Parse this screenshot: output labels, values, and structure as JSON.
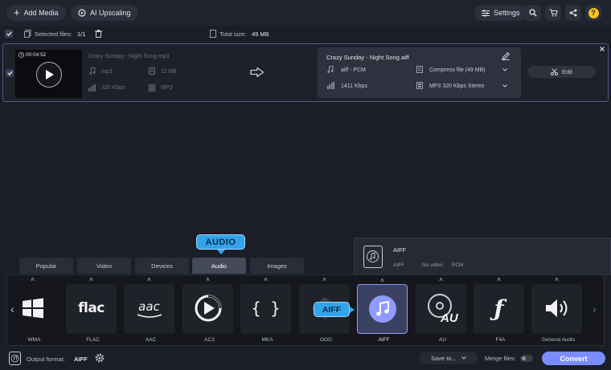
{
  "topbar": {
    "add_media": "Add Media",
    "ai_upscaling": "AI Upscaling",
    "settings": "Settings"
  },
  "subbar": {
    "selected_label": "Selected files:",
    "selected_value": "1/1",
    "total_label": "Total size:",
    "total_value": "49 MB"
  },
  "file": {
    "duration": "00:04:52",
    "name": "Crazy Sunday - Night Song.mp3",
    "format": "mp3",
    "size": "11 MB",
    "bitrate": "320 Kbps",
    "container": "MP3"
  },
  "output": {
    "name": "Crazy Sunday - Night Song.aiff",
    "codec": "aiff - PCM",
    "bitrate": "1411 Kbps",
    "compress": "Compress file (49 MB)",
    "preset": "MP3 320 Kbps Stereo",
    "edit": "Edit"
  },
  "callouts": {
    "audio": "AUDIO",
    "aiff": "AIFF"
  },
  "tabs": [
    "Popular",
    "Video",
    "Devices",
    "Audio",
    "Images"
  ],
  "active_tab": "Audio",
  "tooltip": {
    "title": "AIFF",
    "col1": "AIFF",
    "col2": "No video",
    "col3": "PCM"
  },
  "formats": [
    "WMA",
    "FLAC",
    "AAC",
    "AC3",
    "MKA",
    "OGG",
    "AIFF",
    "AU",
    "F4A",
    "General Audio"
  ],
  "format_icon_text": {
    "flac": "flac",
    "aac": "aac",
    "mka": "{ }",
    "au": "AU"
  },
  "selected_format": "AIFF",
  "bottombar": {
    "output_label": "Output format:",
    "output_value": "AIFF",
    "save_to": "Save to...",
    "merge": "Merge files:",
    "convert": "Convert"
  },
  "colors": {
    "accent": "#7b8cff",
    "callout": "#33a3ea",
    "help": "#f5c518"
  }
}
